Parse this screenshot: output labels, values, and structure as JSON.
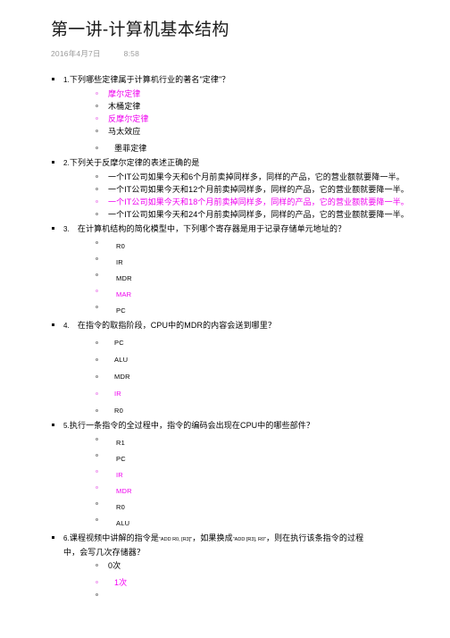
{
  "header": {
    "title": "第一讲-计算机基本结构",
    "date": "2016年4月7日",
    "time": "8:58"
  },
  "colors": {
    "answer_highlight": "#ef00ef",
    "meta_text": "#9a9a9a",
    "body_text": "#000000",
    "background": "#ffffff"
  },
  "questions": [
    {
      "number": "1.",
      "text": "下列哪些定律属于计算机行业的著名\"定律\"？",
      "options": [
        {
          "label": "摩尔定律",
          "marked": true,
          "wrapped": false
        },
        {
          "label": "木桶定律",
          "marked": false,
          "wrapped": false
        },
        {
          "label": "反摩尔定律",
          "marked": true,
          "wrapped": false
        },
        {
          "label": "马太效应",
          "marked": false,
          "wrapped": false
        },
        {
          "label": "墨菲定律",
          "marked": false,
          "wrapped": true
        }
      ]
    },
    {
      "number": "2.",
      "text": "下列关于反摩尔定律的表述正确的是",
      "options": [
        {
          "label": "一个IT公司如果今天和6个月前卖掉同样多，同样的产品，它的营业额就要降一半。",
          "marked": false,
          "wrapped": false
        },
        {
          "label": "一个IT公司如果今天和12个月前卖掉同样多，同样的产品，它的营业额就要降一半。",
          "marked": false,
          "wrapped": false
        },
        {
          "label": "一个IT公司如果今天和18个月前卖掉同样多，同样的产品，它的营业额就要降一半。",
          "marked": true,
          "wrapped": false
        },
        {
          "label": "一个IT公司如果今天和24个月前卖掉同样多，同样的产品，它的营业额就要降一半。",
          "marked": false,
          "wrapped": false
        }
      ]
    },
    {
      "number": "3.",
      "text": "在计算机结构的简化模型中，下列哪个寄存器是用于记录存储单元地址的？",
      "options": [
        {
          "label": "R0",
          "marked": false,
          "wrapped": false,
          "reg": true
        },
        {
          "label": "IR",
          "marked": false,
          "wrapped": false,
          "reg": true
        },
        {
          "label": "MDR",
          "marked": false,
          "wrapped": false,
          "reg": true
        },
        {
          "label": "MAR",
          "marked": true,
          "wrapped": false,
          "reg": true
        },
        {
          "label": "PC",
          "marked": false,
          "wrapped": false,
          "reg": true
        }
      ]
    },
    {
      "number": "4.",
      "text": "在指令的取指阶段，CPU中的MDR的内容会送到哪里？",
      "options": [
        {
          "label": "PC",
          "marked": false,
          "wrapped": true,
          "reg": true
        },
        {
          "label": "ALU",
          "marked": false,
          "wrapped": true,
          "reg": true
        },
        {
          "label": "MDR",
          "marked": false,
          "wrapped": true,
          "reg": true
        },
        {
          "label": "IR",
          "marked": true,
          "wrapped": true,
          "reg": true
        },
        {
          "label": "R0",
          "marked": false,
          "wrapped": true,
          "reg": true
        }
      ]
    },
    {
      "number": "5.",
      "text": "执行一条指令的全过程中，指令的编码会出现在CPU中的哪些部件？",
      "options": [
        {
          "label": "R1",
          "marked": false,
          "wrapped": false,
          "reg": true
        },
        {
          "label": "PC",
          "marked": false,
          "wrapped": false,
          "reg": true
        },
        {
          "label": "IR",
          "marked": true,
          "wrapped": false,
          "reg": true
        },
        {
          "label": "MDR",
          "marked": true,
          "wrapped": false,
          "reg": true
        },
        {
          "label": "R0",
          "marked": false,
          "wrapped": false,
          "reg": true
        },
        {
          "label": "ALU",
          "marked": false,
          "wrapped": false,
          "reg": true
        }
      ]
    },
    {
      "number": "6.",
      "text_part1": "课程视频中讲解的指令是",
      "instruction1": "\"ADD R0, [R3]\"",
      "text_part2": "，如果换成",
      "instruction2": "\"ADD [R3], R0\"",
      "text_part3": "，则在执行该条指令的过程",
      "text_line2": "中，会写几次存储器？",
      "options": [
        {
          "label": "0次",
          "marked": false,
          "wrapped": false
        },
        {
          "label": "1次",
          "marked": true,
          "wrapped": true
        },
        {
          "label": "",
          "marked": false,
          "wrapped": false
        }
      ]
    }
  ]
}
